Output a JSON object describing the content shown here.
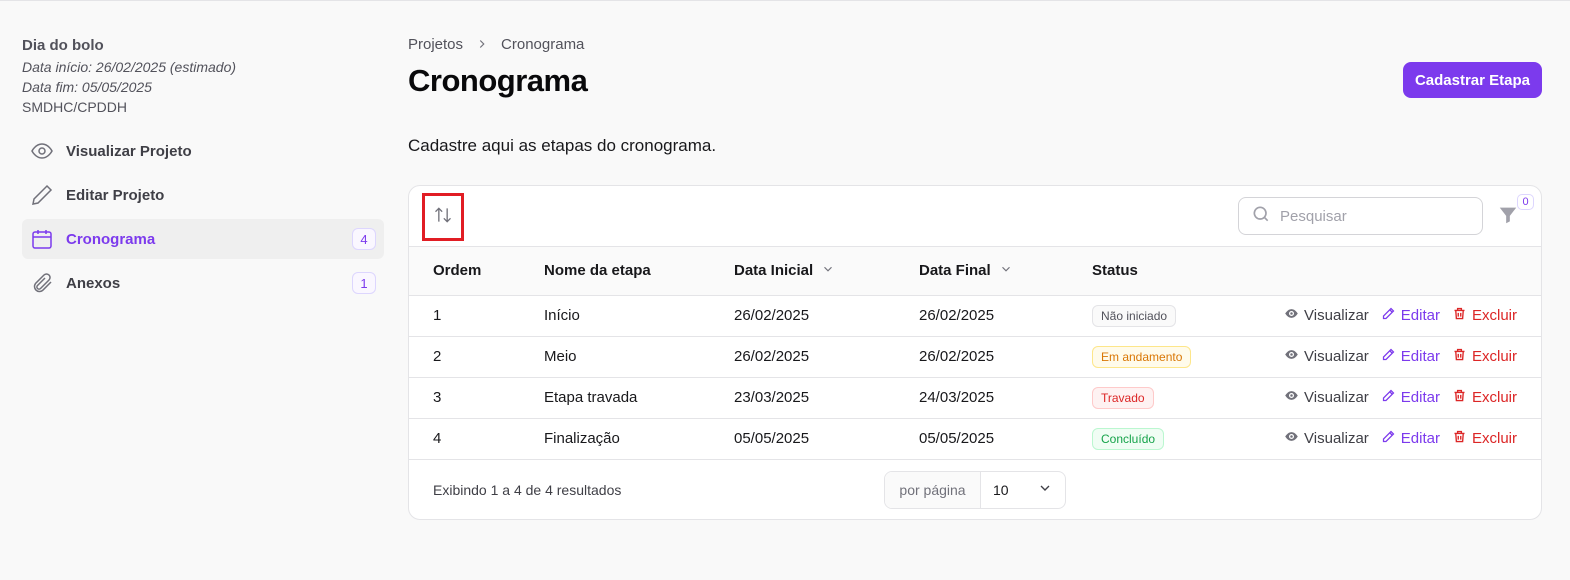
{
  "project": {
    "title": "Dia do bolo",
    "start": "Data início: 26/02/2025 (estimado)",
    "end": "Data fim: 05/05/2025",
    "org": "SMDHC/CPDDH"
  },
  "sidebar": {
    "items": [
      {
        "label": "Visualizar Projeto",
        "icon": "eye-icon",
        "badge": ""
      },
      {
        "label": "Editar Projeto",
        "icon": "pencil-icon",
        "badge": ""
      },
      {
        "label": "Cronograma",
        "icon": "calendar-icon",
        "badge": "4",
        "active": true
      },
      {
        "label": "Anexos",
        "icon": "paperclip-icon",
        "badge": "1"
      }
    ]
  },
  "breadcrumb": [
    "Projetos",
    "Cronograma"
  ],
  "page": {
    "title": "Cronograma",
    "subtitle": "Cadastre aqui as etapas do cronograma.",
    "primary_button": "Cadastrar Etapa"
  },
  "toolbar": {
    "search_placeholder": "Pesquisar",
    "filter_count": "0"
  },
  "table": {
    "columns": [
      "Ordem",
      "Nome da etapa",
      "Data Inicial",
      "Data Final",
      "Status"
    ],
    "rows": [
      {
        "ordem": "1",
        "nome": "Início",
        "inicio": "26/02/2025",
        "fim": "26/02/2025",
        "status": "Não iniciado"
      },
      {
        "ordem": "2",
        "nome": "Meio",
        "inicio": "26/02/2025",
        "fim": "26/02/2025",
        "status": "Em andamento"
      },
      {
        "ordem": "3",
        "nome": "Etapa travada",
        "inicio": "23/03/2025",
        "fim": "24/03/2025",
        "status": "Travado"
      },
      {
        "ordem": "4",
        "nome": "Finalização",
        "inicio": "05/05/2025",
        "fim": "05/05/2025",
        "status": "Concluído"
      }
    ],
    "actions": {
      "view": "Visualizar",
      "edit": "Editar",
      "delete": "Excluir"
    }
  },
  "status_colors": {
    "Não iniciado": {
      "text": "#52525b",
      "bg": "#fafafa",
      "border": "#e4e4e7"
    },
    "Em andamento": {
      "text": "#d97706",
      "bg": "#fffbeb",
      "border": "#fde68a"
    },
    "Travado": {
      "text": "#dc2626",
      "bg": "#fef2f2",
      "border": "#fecaca"
    },
    "Concluído": {
      "text": "#16a34a",
      "bg": "#f0fdf4",
      "border": "#bbf7d0"
    }
  },
  "footer": {
    "count_text": "Exibindo 1 a 4 de 4 resultados",
    "per_page_label": "por página",
    "per_page_value": "10"
  },
  "colors": {
    "accent": "#7c3aed",
    "danger": "#dc2626"
  }
}
